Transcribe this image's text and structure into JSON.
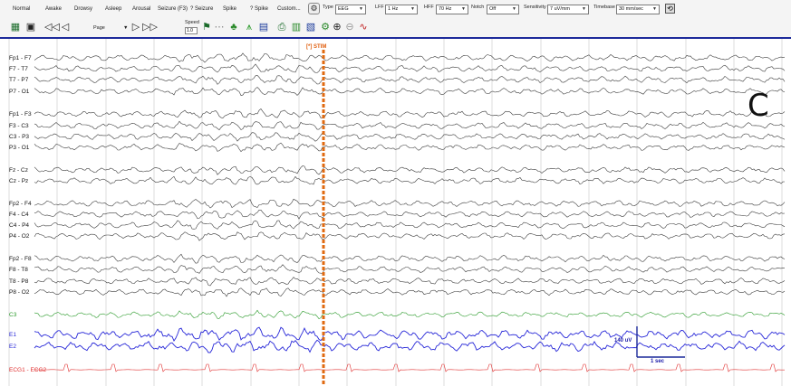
{
  "colors": {
    "trace": "#3c3c3c",
    "green": "#2a9a2a",
    "blue": "#2828d8",
    "red": "#e03030",
    "stim": "#e06a10",
    "grid": "#c8c8c8",
    "header_bar": "#1c2a9a"
  },
  "event_buttons": [
    "Normal",
    "Awake",
    "Drowsy",
    "Asleep",
    "Arousal",
    "Seizure (F3)",
    "? Seizure",
    "Spike",
    "? Spike",
    "Custom..."
  ],
  "controls": {
    "type_label": "Type",
    "type_value": "EEG",
    "lff_label": "LFF",
    "lff_value": "1 Hz",
    "hff_label": "HFF",
    "hff_value": "70 Hz",
    "notch_label": "Notch",
    "notch_value": "Off",
    "sensitivity_label": "Sensitivity",
    "sensitivity_value": "7 uV/mm",
    "timebase_label": "Timebase",
    "timebase_value": "30 mm/sec"
  },
  "toolbar2": {
    "page_label": "Page",
    "speed_label": "Speed",
    "speed_value": "1.0",
    "icons": [
      "montage-icon",
      "video-icon",
      "rewind-icon",
      "step-back-icon",
      "step-forward-icon",
      "fast-forward-icon",
      "flag-icon",
      "hide-icon",
      "tree-icon",
      "spectrum-icon",
      "report-icon",
      "print-icon",
      "export-icon",
      "db-icon",
      "zoom-in-icon",
      "zoom-out-icon",
      "markers-icon"
    ]
  },
  "stim_marker": "[*] STIM",
  "panel_letter": "C",
  "calibration": {
    "amplitude": "140 uV",
    "time": "1 sec"
  },
  "channels": [
    {
      "label": "Fp1 - F7",
      "color": "trace",
      "type": "eeg"
    },
    {
      "label": "F7 - T7",
      "color": "trace",
      "type": "eeg"
    },
    {
      "label": "T7 - P7",
      "color": "trace",
      "type": "eeg"
    },
    {
      "label": "P7 - O1",
      "color": "trace",
      "type": "eeg"
    },
    {
      "label": "Fp1 - F3",
      "color": "trace",
      "type": "eeg"
    },
    {
      "label": "F3 - C3",
      "color": "trace",
      "type": "eeg"
    },
    {
      "label": "C3 - P3",
      "color": "trace",
      "type": "eeg"
    },
    {
      "label": "P3 - O1",
      "color": "trace",
      "type": "eeg"
    },
    {
      "label": "Fz - Cz",
      "color": "trace",
      "type": "eeg"
    },
    {
      "label": "Cz - Pz",
      "color": "trace",
      "type": "eeg"
    },
    {
      "label": "Fp2 - F4",
      "color": "trace",
      "type": "eeg"
    },
    {
      "label": "F4 - C4",
      "color": "trace",
      "type": "eeg"
    },
    {
      "label": "C4 - P4",
      "color": "trace",
      "type": "eeg"
    },
    {
      "label": "P4 - O2",
      "color": "trace",
      "type": "eeg"
    },
    {
      "label": "Fp2 - F8",
      "color": "trace",
      "type": "eeg"
    },
    {
      "label": "F8 - T8",
      "color": "trace",
      "type": "eeg"
    },
    {
      "label": "T8 - P8",
      "color": "trace",
      "type": "eeg"
    },
    {
      "label": "P8 - O2",
      "color": "trace",
      "type": "eeg"
    },
    {
      "label": "C3",
      "color": "green",
      "type": "single"
    },
    {
      "label": "E1",
      "color": "blue",
      "type": "eog"
    },
    {
      "label": "E2",
      "color": "blue",
      "type": "eog"
    },
    {
      "label": "ECG1 - ECG2",
      "color": "red",
      "type": "ecg"
    }
  ]
}
